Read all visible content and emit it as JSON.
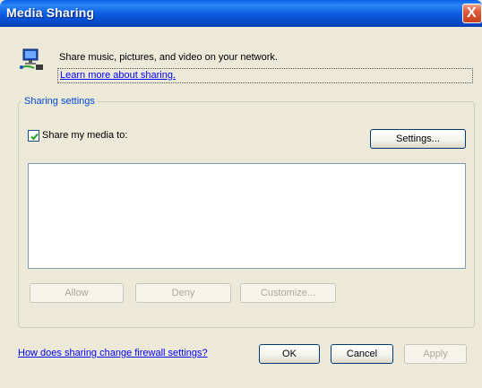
{
  "window": {
    "title": "Media Sharing",
    "close_label": "X"
  },
  "info": {
    "icon": "network-media-icon",
    "description": "Share music, pictures, and video on your network.",
    "learn_more": "Learn more about sharing."
  },
  "sharing_settings": {
    "group_label": "Sharing settings",
    "share_checkbox": {
      "label": "Share my media to:",
      "checked": true
    },
    "settings_button": "Settings...",
    "devices": [],
    "allow_button": "Allow",
    "deny_button": "Deny",
    "customize_button": "Customize..."
  },
  "footer": {
    "firewall_link": "How does sharing change firewall settings?",
    "ok_button": "OK",
    "cancel_button": "Cancel",
    "apply_button": "Apply"
  },
  "colors": {
    "titlebar": "#0a5fe8",
    "accent_link": "#0000ff",
    "dialog_bg": "#ece9d8",
    "group_label": "#0046d5"
  }
}
